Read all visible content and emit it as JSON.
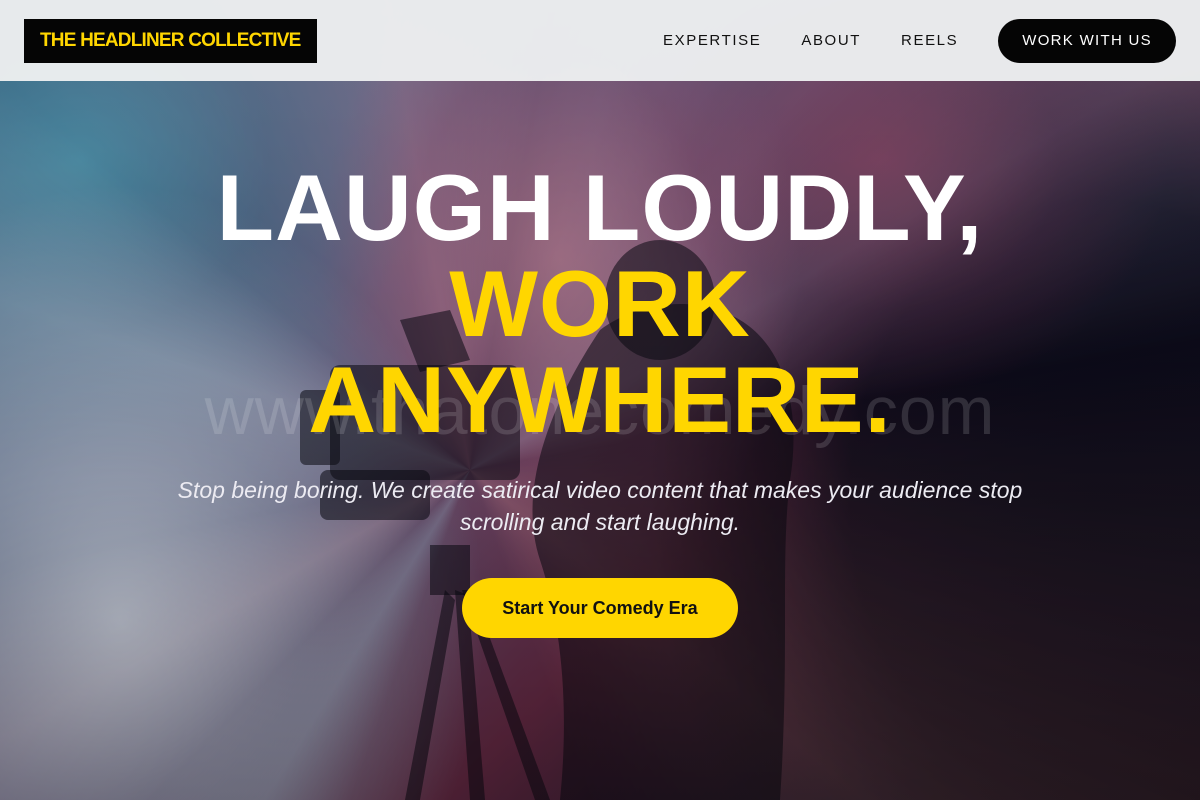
{
  "header": {
    "logo_text": "THE HEADLINER COLLECTIVE",
    "nav": [
      {
        "label": "EXPERTISE"
      },
      {
        "label": "ABOUT"
      },
      {
        "label": "REELS"
      }
    ],
    "cta_label": "WORK WITH US"
  },
  "hero": {
    "headline_line1": "LAUGH LOUDLY,",
    "headline_line2": "WORK",
    "headline_line3": "ANYWHERE.",
    "subtitle": "Stop being boring. We create satirical video content that makes your audience stop scrolling and start laughing.",
    "cta_label": "Start Your Comedy Era",
    "watermark": "www.thatonecomedy.com"
  },
  "colors": {
    "accent": "#ffd600",
    "dark": "#050505",
    "header_bg": "#eceef0"
  }
}
